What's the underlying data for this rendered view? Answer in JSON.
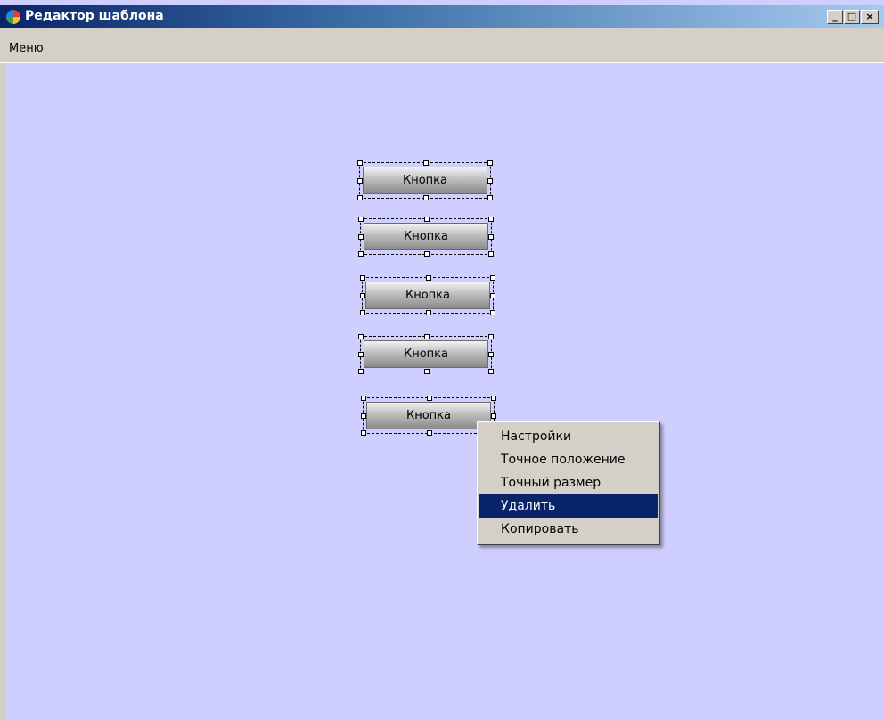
{
  "window": {
    "title": "Редактор шаблона",
    "controls": {
      "minimize": "_",
      "maximize": "□",
      "close": "×"
    }
  },
  "menubar": {
    "items": [
      "Меню"
    ]
  },
  "canvas": {
    "background": "#cfcfff",
    "buttons": [
      {
        "label": "Кнопка"
      },
      {
        "label": "Кнопка"
      },
      {
        "label": "Кнопка"
      },
      {
        "label": "Кнопка"
      },
      {
        "label": "Кнопка"
      }
    ]
  },
  "context_menu": {
    "items": [
      {
        "label": "Настройки",
        "highlighted": false
      },
      {
        "label": "Точное положение",
        "highlighted": false
      },
      {
        "label": "Точный размер",
        "highlighted": false
      },
      {
        "label": "Удалить",
        "highlighted": true
      },
      {
        "label": "Копировать",
        "highlighted": false
      }
    ]
  },
  "colors": {
    "accent": "#0a246a",
    "chrome": "#d4d0c8"
  }
}
